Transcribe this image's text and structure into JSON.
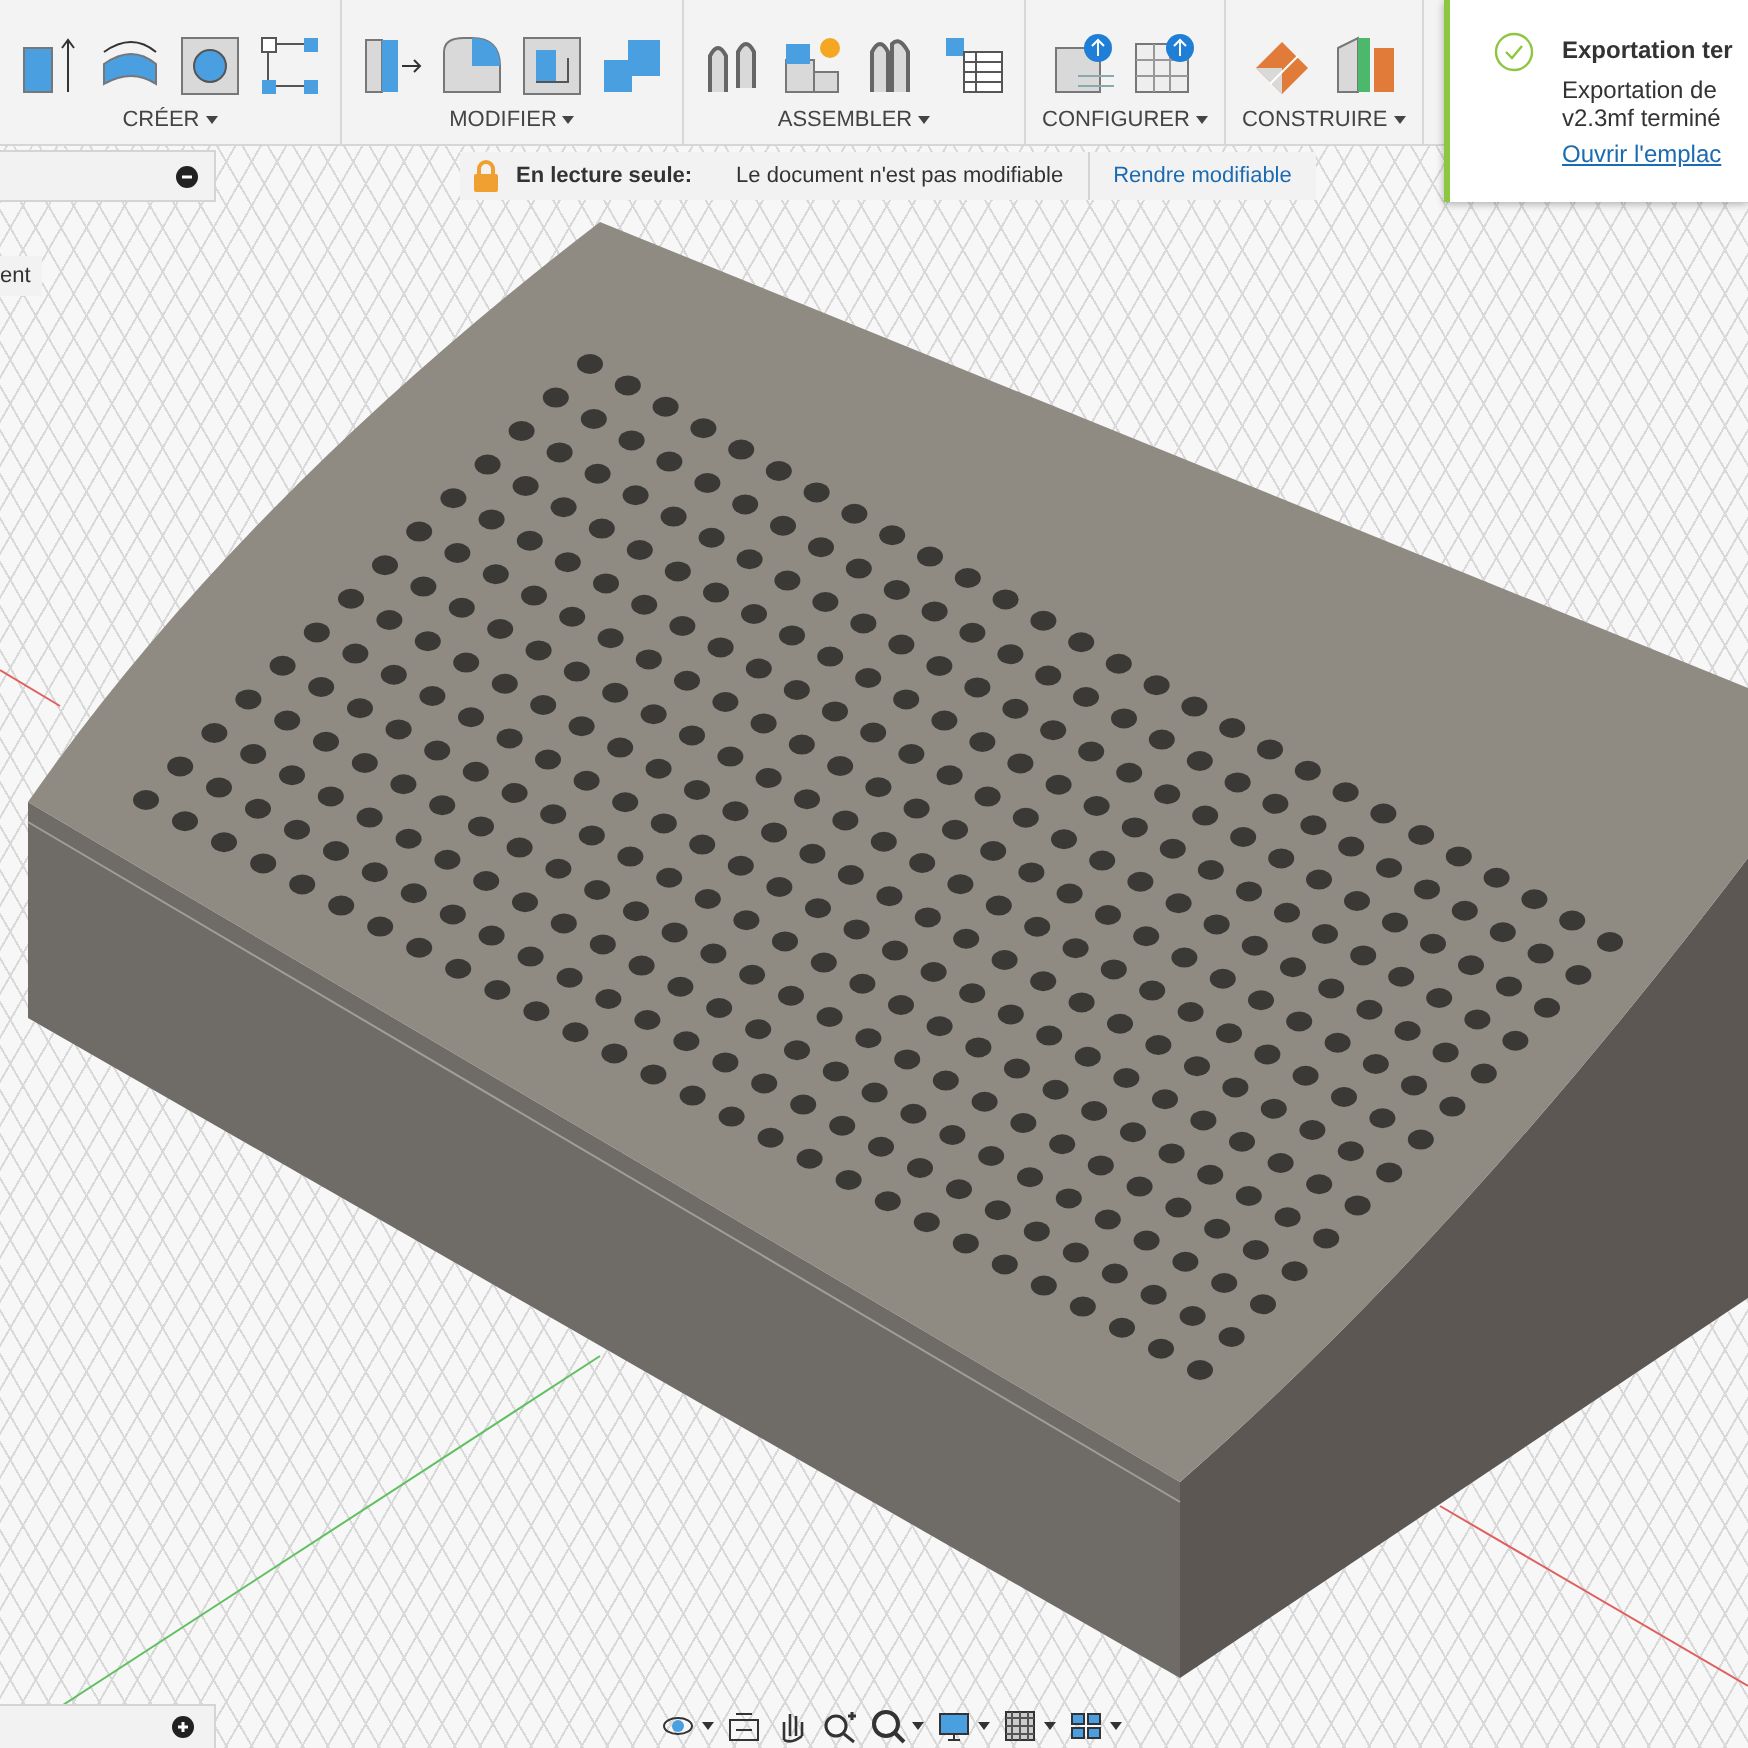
{
  "toolbar": {
    "groups": [
      {
        "label": "CRÉER"
      },
      {
        "label": "MODIFIER"
      },
      {
        "label": "ASSEMBLER"
      },
      {
        "label": "CONFIGURER"
      },
      {
        "label": "CONSTRUIRE"
      }
    ]
  },
  "browser_panel": {
    "collapsed": false
  },
  "side_tab": {
    "label": "ent"
  },
  "readonly_bar": {
    "title": "En lecture seule:",
    "message": "Le document n'est pas modifiable",
    "action": "Rendre modifiable"
  },
  "notification": {
    "title": "Exportation ter",
    "lines": [
      "Exportation de",
      "v2.3mf terminé"
    ],
    "link": "Ouvrir l'emplac"
  },
  "comments_panel": {
    "collapsed": true
  }
}
